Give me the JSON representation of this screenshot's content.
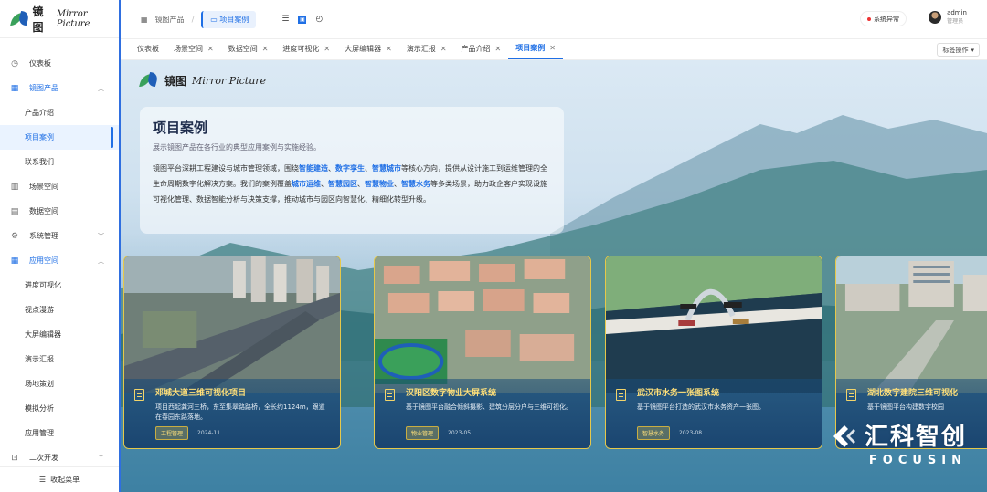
{
  "app": {
    "logo_cn": "镜图",
    "logo_en": "Mirror Picture"
  },
  "sidebar": {
    "items": [
      {
        "label": "仪表板",
        "icon": "dashboard-icon"
      },
      {
        "label": "镜图产品",
        "icon": "grid-icon",
        "expanded": true
      },
      {
        "label": "产品介绍"
      },
      {
        "label": "项目案例",
        "active": true
      },
      {
        "label": "联系我们"
      },
      {
        "label": "场景空间",
        "icon": "scene-icon"
      },
      {
        "label": "数据空间",
        "icon": "data-icon"
      },
      {
        "label": "系统管理",
        "icon": "gear-icon"
      },
      {
        "label": "应用空间",
        "icon": "grid-icon",
        "expanded": true
      },
      {
        "label": "进度可视化"
      },
      {
        "label": "视点漫游"
      },
      {
        "label": "大屏编辑器"
      },
      {
        "label": "演示汇报"
      },
      {
        "label": "场地策划"
      },
      {
        "label": "模拟分析"
      },
      {
        "label": "应用管理"
      },
      {
        "label": "二次开发",
        "icon": "code-icon"
      }
    ],
    "collapse_label": "收起菜单"
  },
  "header": {
    "breadcrumb": [
      "镜图产品",
      "项目案例"
    ],
    "status": "系统异常",
    "user_name": "admin",
    "user_role": "管理员"
  },
  "tabs": [
    "仪表板",
    "场景空间",
    "数据空间",
    "进度可视化",
    "大屏编辑器",
    "演示汇报",
    "产品介绍",
    "项目案例"
  ],
  "tab_ops": "标签操作",
  "intro": {
    "title": "项目案例",
    "subtitle": "展示镜图产品在各行业的典型应用案例与实施经验。",
    "desc_parts": [
      "镜图平台深耕工程建设与城市管理领域，围绕",
      "智能建造",
      "、",
      "数字孪生",
      "、",
      "智慧城市",
      "等核心方向，提供从设计施工到运维管理的全生命周期数字化解决方案。我们的案例覆盖",
      "城市运维",
      "、",
      "智慧园区",
      "、",
      "智慧物业",
      "、",
      "智慧水务",
      "等多类场景，助力政企客户实现设施可视化管理、数据智能分析与决策支撑，推动城市与园区向智慧化、精细化转型升级。"
    ]
  },
  "cards": [
    {
      "title": "邓城大道三维可视化项目",
      "desc": "项目西起龚河三桥，东至集翠路路桥，全长约1124m，跟道在春园东路落地。",
      "tag": "工程管理",
      "date": "2024-11"
    },
    {
      "title": "汉阳区数字物业大屏系统",
      "desc": "基于镜图平台融合倾斜摄影、建筑分层分户与三维可视化。",
      "tag": "物业管理",
      "date": "2023-05"
    },
    {
      "title": "武汉市水务一张图系统",
      "desc": "基于镜图平台打造的武汉市水务资产一张图。",
      "tag": "智慧水务",
      "date": "2023-08"
    },
    {
      "title": "湖北数字建院三维可视化",
      "desc": "基于镜图平台构建数字校园",
      "tag": "",
      "date": ""
    }
  ],
  "watermark": {
    "cn": "汇科智创",
    "en": "FOCUSIN"
  },
  "colors": {
    "accent": "#1f6fe5",
    "card_border": "#e6c84a",
    "card_title": "#ffe07a"
  }
}
